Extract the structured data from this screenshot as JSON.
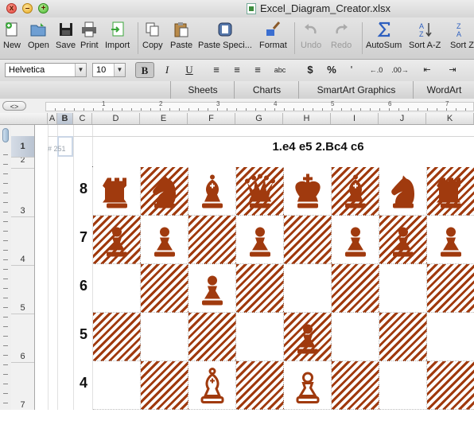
{
  "window": {
    "title": "Excel_Diagram_Creator.xlsx",
    "traffic_lights": {
      "close": "x",
      "minimize": "–",
      "maximize": "+"
    }
  },
  "toolbar": {
    "buttons": [
      {
        "label": "New",
        "icon": "new-workbook-icon",
        "enabled": true
      },
      {
        "label": "Open",
        "icon": "open-folder-icon",
        "enabled": true
      },
      {
        "label": "Save",
        "icon": "save-disk-icon",
        "enabled": true
      },
      {
        "label": "Print",
        "icon": "printer-icon",
        "enabled": true
      },
      {
        "label": "Import",
        "icon": "import-icon",
        "enabled": true
      },
      {
        "label": "Copy",
        "icon": "copy-icon",
        "enabled": true
      },
      {
        "label": "Paste",
        "icon": "paste-icon",
        "enabled": true
      },
      {
        "label": "Paste Speci...",
        "icon": "paste-special-icon",
        "enabled": true
      },
      {
        "label": "Format",
        "icon": "format-brush-icon",
        "enabled": true
      },
      {
        "label": "Undo",
        "icon": "undo-icon",
        "enabled": false
      },
      {
        "label": "Redo",
        "icon": "redo-icon",
        "enabled": false
      },
      {
        "label": "AutoSum",
        "icon": "sigma-icon",
        "enabled": true
      },
      {
        "label": "Sort A-Z",
        "icon": "sort-az-icon",
        "enabled": true
      },
      {
        "label": "Sort Z",
        "icon": "sort-za-icon",
        "enabled": true
      }
    ]
  },
  "format_bar": {
    "font_name": "Helvetica",
    "font_size": "10",
    "bold": "B",
    "italic": "I",
    "underline": "U",
    "currency": "$",
    "percent": "%",
    "thousands": "'",
    "wrap": "abc"
  },
  "ribbon_tabs": [
    "Sheets",
    "Charts",
    "SmartArt Graphics",
    "WordArt"
  ],
  "ruler": {
    "numbers": [
      "1",
      "2",
      "3",
      "4",
      "5",
      "6",
      "7"
    ]
  },
  "columns": [
    "A",
    "B",
    "C",
    "D",
    "E",
    "F",
    "G",
    "H",
    "I",
    "J",
    "K"
  ],
  "rows": [
    "1",
    "2",
    "3",
    "4",
    "5",
    "6",
    "7"
  ],
  "selected_column": "B",
  "selected_row": "1",
  "sheet": {
    "cell_ref": "# 251",
    "heading": "1.e4 e5 2.Bc4 c6"
  },
  "chess": {
    "piece_color": "#a03a0e",
    "ranks": [
      "8",
      "7",
      "6",
      "5",
      "4"
    ],
    "board": [
      [
        "bR",
        "bN",
        "bB",
        "bQ",
        "bK",
        "bB",
        "bN",
        "bR"
      ],
      [
        "bP",
        "bP",
        "",
        "bP",
        "",
        "bP",
        "bP",
        "bP"
      ],
      [
        "",
        "",
        "bP",
        "",
        "",
        "",
        "",
        ""
      ],
      [
        "",
        "",
        "",
        "",
        "bP",
        "",
        "",
        ""
      ],
      [
        "",
        "",
        "wB",
        "",
        "wP",
        "",
        "",
        ""
      ]
    ]
  }
}
